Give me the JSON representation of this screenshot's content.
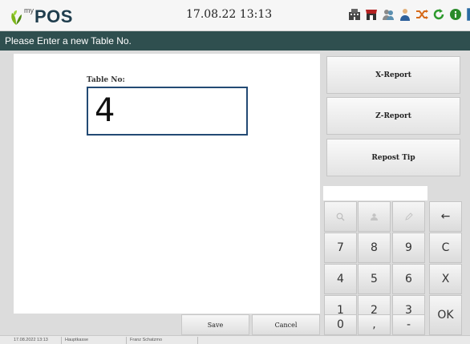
{
  "header": {
    "logo_my": "my",
    "logo_pos": "POS",
    "datetime": "17.08.22  13:13",
    "icons": [
      "building-icon",
      "shop-icon",
      "users-icon",
      "user-icon",
      "shuffle-icon",
      "refresh-icon",
      "info-icon",
      "window-icon"
    ]
  },
  "titlebar": {
    "text": "Please Enter a new Table No."
  },
  "form": {
    "table_label": "Table No:",
    "table_value": "4"
  },
  "buttons": {
    "save": "Save",
    "cancel": "Cancel"
  },
  "reports": {
    "x_report": "X-Report",
    "z_report": "Z-Report",
    "repost_tip": "Repost Tip"
  },
  "keypad": {
    "display_value": "",
    "top_icons": [
      "search-icon",
      "person-icon",
      "edit-icon"
    ],
    "backspace": "←",
    "row1": [
      "7",
      "8",
      "9",
      "C"
    ],
    "row2": [
      "4",
      "5",
      "6",
      "X"
    ],
    "row3": [
      "1",
      "2",
      "3"
    ],
    "row4": [
      "0",
      ",",
      "-"
    ],
    "ok": "OK"
  },
  "status": {
    "datetime": "17.08.2022 13:13",
    "register": "Hauptkasse",
    "user": "Franz Schatzmo"
  },
  "colors": {
    "titlebar": "#2f4f4f",
    "input_border": "#234a74",
    "logo": "#1f3d4d"
  }
}
